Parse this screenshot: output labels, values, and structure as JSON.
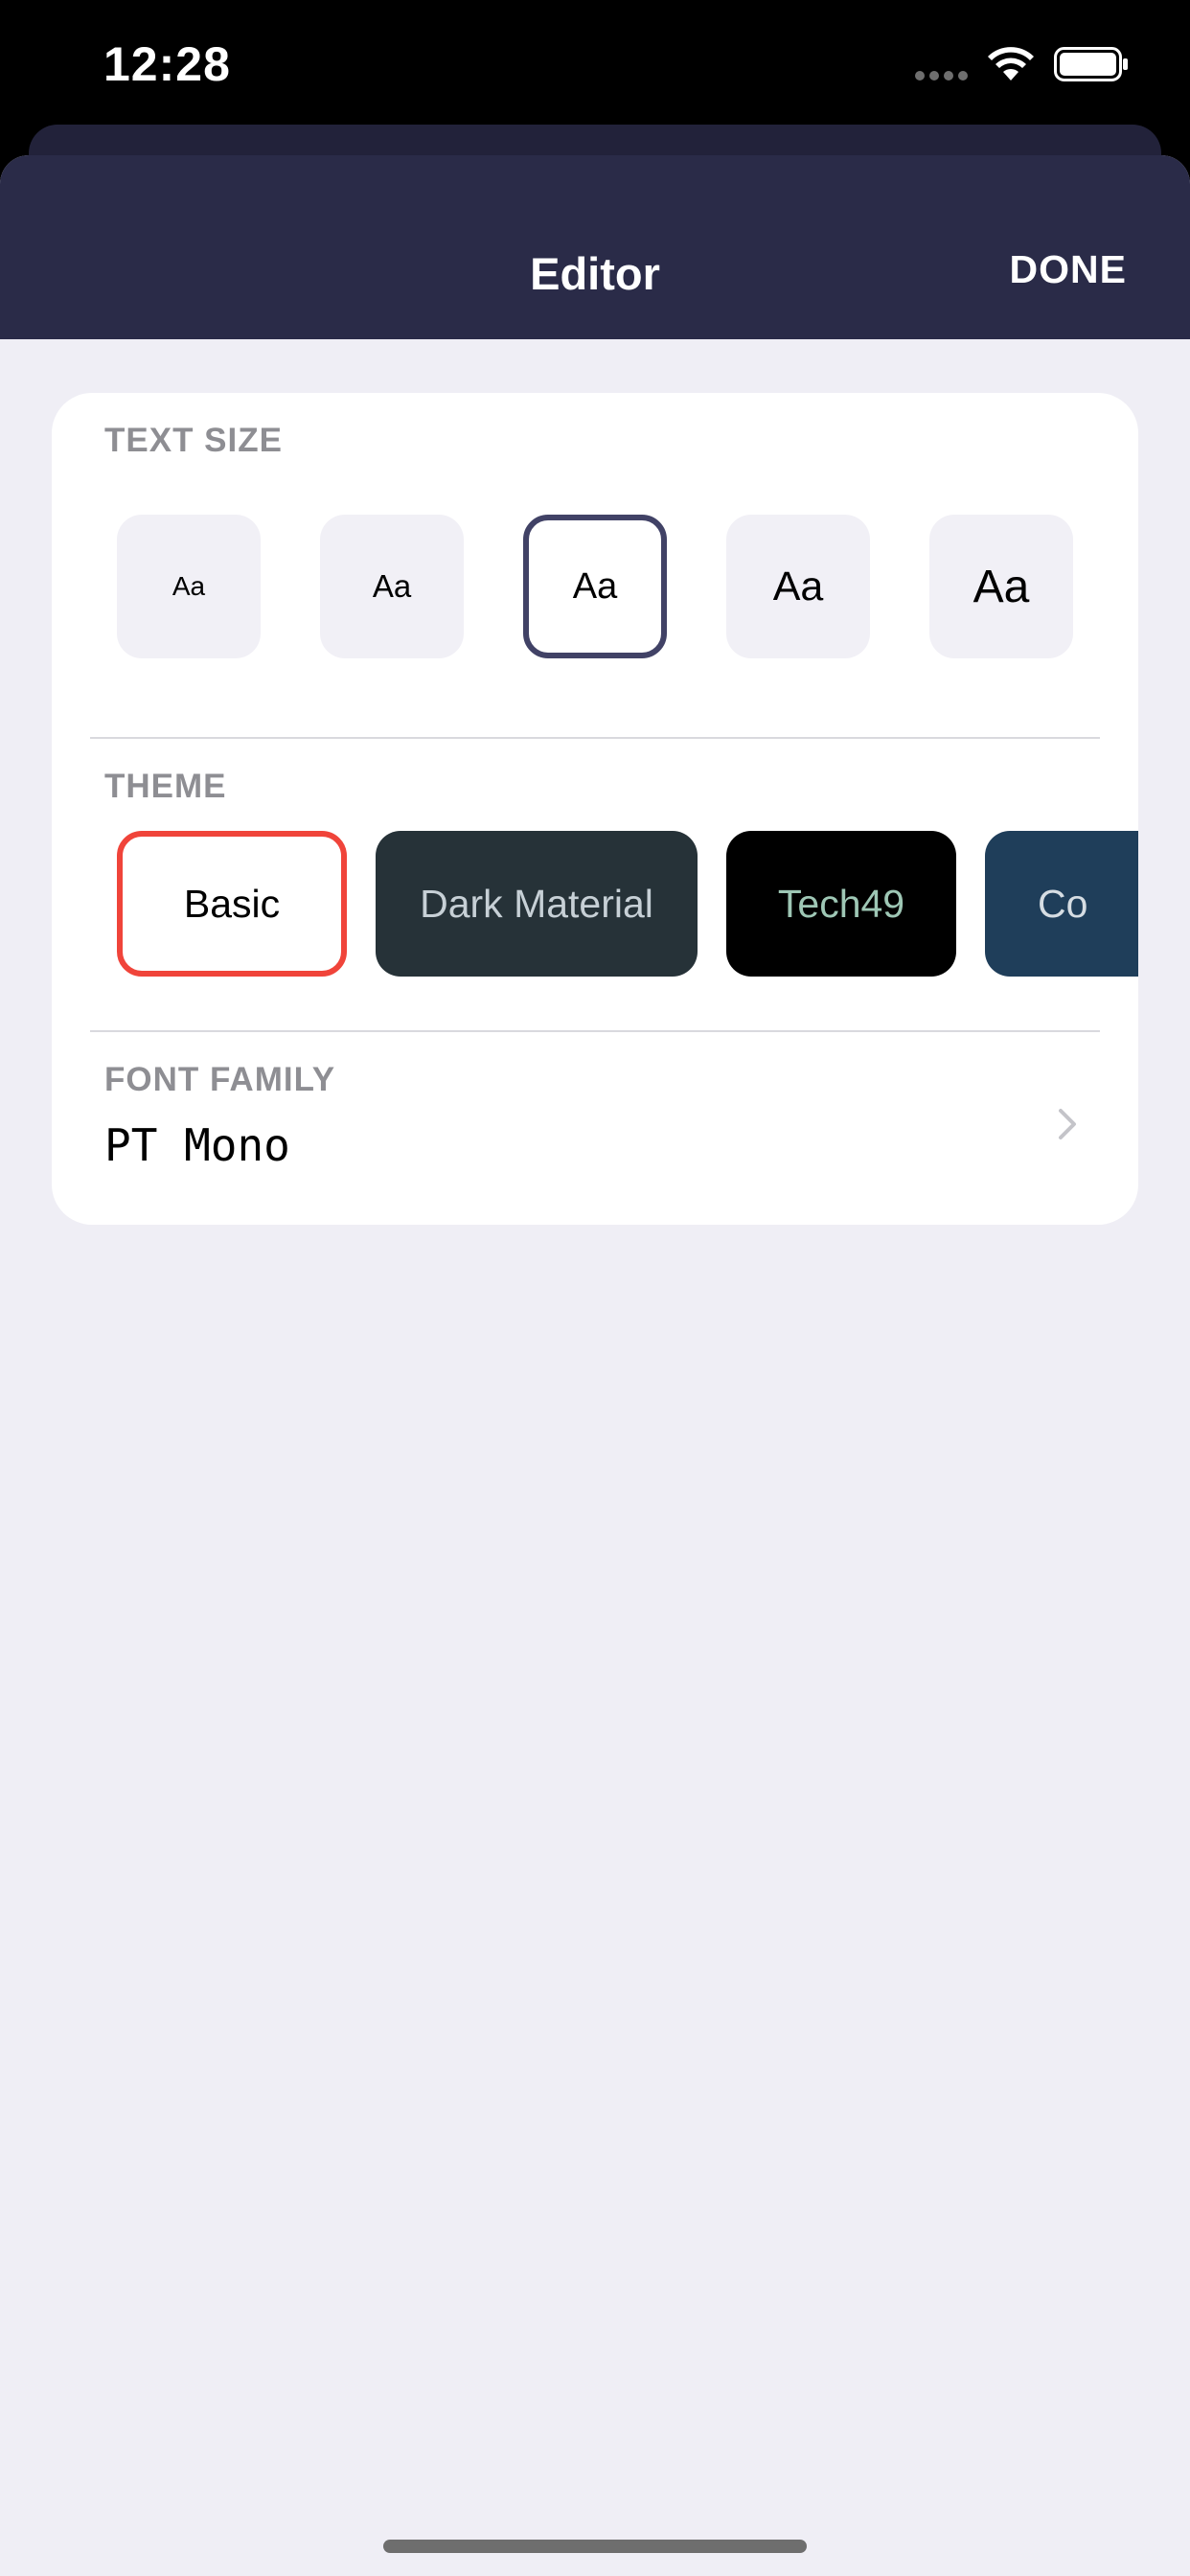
{
  "status_bar": {
    "time": "12:28",
    "icons": [
      "cellular-signal-icon",
      "wifi-icon",
      "battery-icon"
    ]
  },
  "nav": {
    "title": "Editor",
    "done_label": "DONE"
  },
  "text_size": {
    "label": "TEXT SIZE",
    "options": [
      {
        "label": "Aa",
        "selected": false
      },
      {
        "label": "Aa",
        "selected": false
      },
      {
        "label": "Aa",
        "selected": true
      },
      {
        "label": "Aa",
        "selected": false
      },
      {
        "label": "Aa",
        "selected": false
      }
    ]
  },
  "theme": {
    "label": "THEME",
    "options": [
      {
        "label": "Basic",
        "selected": true,
        "background": "#ffffff",
        "text_color": "#000000"
      },
      {
        "label": "Dark Material",
        "selected": false,
        "background": "#263238",
        "text_color": "#c7d0d6"
      },
      {
        "label": "Tech49",
        "selected": false,
        "background": "#000000",
        "text_color": "#9ec7b5"
      },
      {
        "label": "Co",
        "selected": false,
        "background": "#1f3e5a",
        "text_color": "#d6dde3"
      }
    ]
  },
  "font_family": {
    "label": "FONT FAMILY",
    "value": "PT Mono"
  },
  "colors": {
    "nav_background": "#2a2b48",
    "selected_size_border": "#414266",
    "selected_theme_border": "#f0443a",
    "page_background": "#efeef5"
  }
}
